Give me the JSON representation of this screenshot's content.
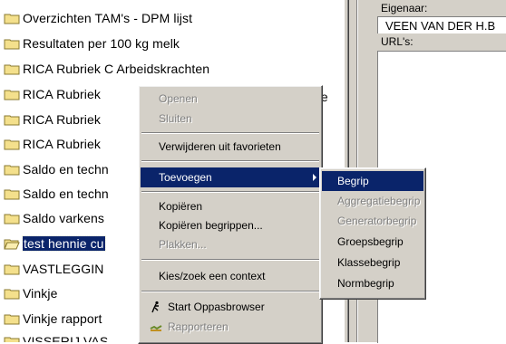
{
  "tree": {
    "items": [
      {
        "label": "Overzichten TAM's - DPM lijst"
      },
      {
        "label": "Resultaten per 100 kg melk"
      },
      {
        "label": "RICA Rubriek C Arbeidskrachten"
      },
      {
        "label": "RICA Rubriek"
      },
      {
        "label": "RICA Rubriek"
      },
      {
        "label": "RICA Rubriek"
      },
      {
        "label": "Saldo en techn"
      },
      {
        "label": "Saldo en techn"
      },
      {
        "label": "Saldo varkens"
      },
      {
        "label": "test hennie cu",
        "selected": true
      },
      {
        "label": "VASTLEGGIN"
      },
      {
        "label": "Vinkje"
      },
      {
        "label": "Vinkje rapport"
      },
      {
        "label": "VISSERIJ VAS"
      }
    ],
    "truncated_fragment": "die"
  },
  "properties": {
    "owner_label": "Eigenaar:",
    "owner_value": "VEEN VAN DER H.B",
    "urls_label": "URL's:"
  },
  "context_menu": {
    "items": [
      {
        "label": "Openen",
        "disabled": true
      },
      {
        "label": "Sluiten",
        "disabled": true
      },
      {
        "label": "Verwijderen uit favorieten",
        "disabled": false
      },
      {
        "label": "Toevoegen",
        "disabled": false,
        "highlighted": true,
        "submenu": true
      },
      {
        "label": "Kopiëren",
        "disabled": false
      },
      {
        "label": "Kopiëren begrippen...",
        "disabled": false
      },
      {
        "label": "Plakken...",
        "disabled": true
      },
      {
        "label": "Kies/zoek een context",
        "disabled": false
      },
      {
        "label": "Start Oppasbrowser",
        "disabled": false,
        "icon": "oppas-icon"
      },
      {
        "label": "Rapporteren",
        "disabled": true,
        "icon": "report-icon"
      }
    ]
  },
  "submenu": {
    "items": [
      {
        "label": "Begrip",
        "highlighted": true
      },
      {
        "label": "Aggregatiebegrip",
        "disabled": true
      },
      {
        "label": "Generatorbegrip",
        "disabled": true
      },
      {
        "label": "Groepsbegrip"
      },
      {
        "label": "Klassebegrip"
      },
      {
        "label": "Normbegrip"
      }
    ]
  },
  "colors": {
    "selection": "#0a246a",
    "face": "#d4d0c8",
    "folder": "#f4e08c"
  }
}
